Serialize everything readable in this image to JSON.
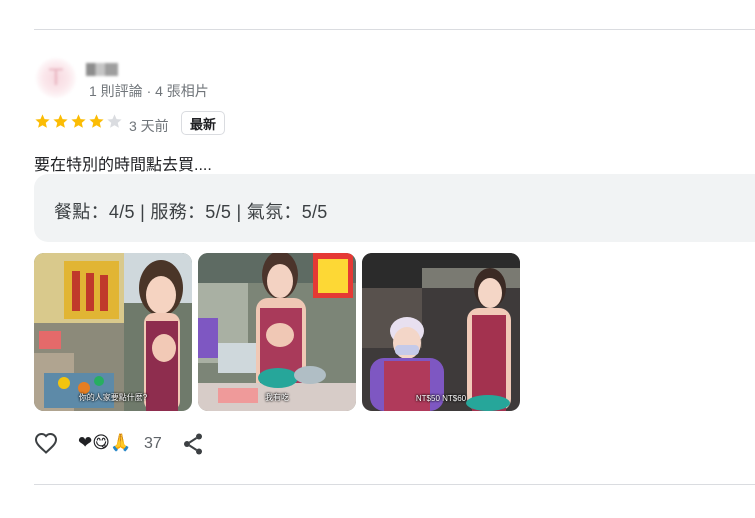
{
  "reviewer": {
    "avatar_letter": "T",
    "meta": "1 則評論 · 4 張相片"
  },
  "rating": {
    "stars": 4,
    "max": 5,
    "star_color": "#fbbc04",
    "empty_color": "#dadce0"
  },
  "time_ago": "3 天前",
  "badge": "最新",
  "review_text": "要在特別的時間點去買....",
  "summary": "餐點：4/5 | 服務：5/5 | 氣氛：5/5",
  "photos": [
    {
      "icon": "photo-1",
      "caption": "你的人家要點什麼?"
    },
    {
      "icon": "photo-2",
      "caption": "我有吃"
    },
    {
      "icon": "photo-3",
      "caption": "NT$50 NT$60"
    }
  ],
  "reactions": {
    "emojis": "❤😋🙏",
    "count": "37"
  },
  "icons": {
    "like": "heart-outline-icon",
    "share": "share-icon"
  }
}
